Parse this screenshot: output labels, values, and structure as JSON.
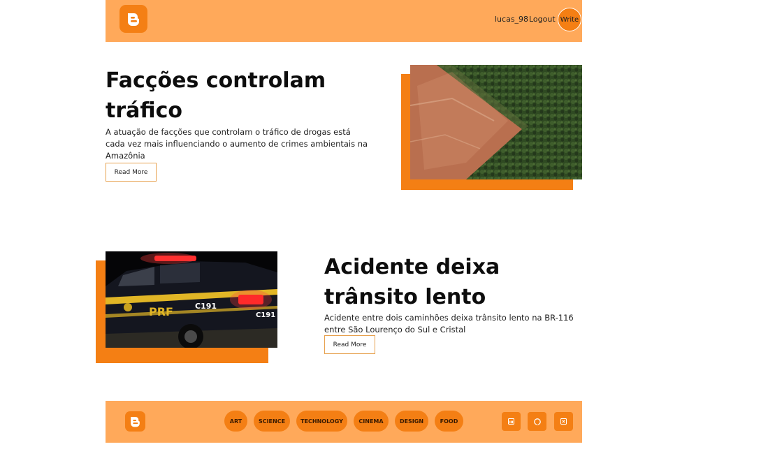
{
  "header": {
    "logo_icon": "blogger-logo-icon",
    "username": "lucas_98",
    "logout_label": "Logout",
    "write_label": "Write"
  },
  "posts": [
    {
      "title_line1": "Facções controlam",
      "title_line2": "tráfico",
      "description": "A atuação de facções que controlam o tráfico de drogas está cada vez mais influenciando o aumento de crimes ambientais na Amazônia",
      "read_more_label": "Read More",
      "image": "deforestation-aerial-photo"
    },
    {
      "title_line1": "Acidente deixa",
      "title_line2": "trânsito lento",
      "description": "Acidente entre dois caminhões deixa trânsito lento na BR-116 entre São Lourenço do Sul e Cristal",
      "read_more_label": "Read More",
      "image": "prf-police-car-photo"
    }
  ],
  "footer": {
    "logo_icon": "blogger-logo-icon",
    "categories": [
      "ART",
      "SCIENCE",
      "TECHNOLOGY",
      "CINEMA",
      "DESIGN",
      "FOOD"
    ],
    "social_icons": [
      "linkedin-icon",
      "github-icon",
      "close-square-icon"
    ]
  },
  "colors": {
    "header_bg": "#ffa95a",
    "accent": "#f47f14",
    "button_border": "#e7a14e"
  }
}
